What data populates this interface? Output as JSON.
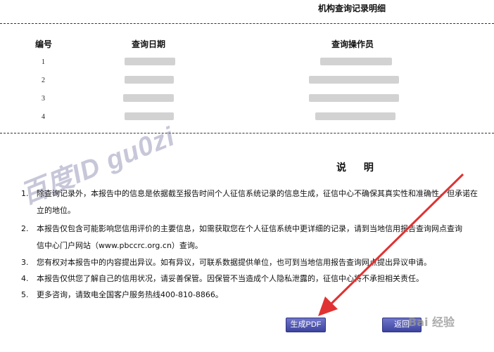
{
  "section": {
    "title": "机构查询记录明细"
  },
  "table": {
    "headers": [
      "编号",
      "查询日期",
      "查询操作员"
    ],
    "row_numbers": [
      "1",
      "2",
      "3",
      "4"
    ]
  },
  "watermark": {
    "text": "百度ID gu0zi"
  },
  "explanation": {
    "title": "说 明",
    "notes": [
      {
        "num": "1.",
        "lines": [
          "除查询记录外，本报告中的信息是依据截至报告时间个人征信系统记录的信息生成，征信中心不确保其真实性和准确性，但承诺在",
          "立的地位。"
        ]
      },
      {
        "num": "2.",
        "lines": [
          "本报告仅包含可能影响您信用评价的主要信息，如需获取您在个人征信系统中更详细的记录，请到当地信用报告查询网点查询",
          "信中心门户网站（www.pbccrc.org.cn）查询。"
        ]
      },
      {
        "num": "3.",
        "lines": [
          "您有权对本报告中的内容提出异议。如有异议，可联系数据提供单位，也可到当地信用报告查询网点提出异议申请。"
        ]
      },
      {
        "num": "4.",
        "lines": [
          "本报告仅供您了解自己的信用状况，请妥善保管。因保管不当造成个人隐私泄露的，征信中心将不承担相关责任。"
        ]
      },
      {
        "num": "5.",
        "lines": [
          "更多咨询，请致电全国客户服务热线400-810-8866。"
        ]
      }
    ]
  },
  "buttons": {
    "pdf_label": "生成PDF",
    "return_label": "返回"
  },
  "logo": {
    "text": "Bai 经验"
  },
  "colors": {
    "button": "#4a51ad",
    "arrow": "#e03232"
  }
}
